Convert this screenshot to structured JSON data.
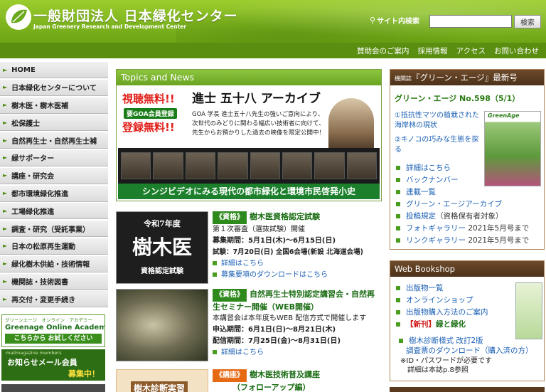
{
  "header": {
    "title": "一般財団法人 日本緑化センター",
    "subtitle": "Japan Greenery Research and Development Center",
    "search_label": "サイト内検索",
    "search_placeholder": "",
    "search_button": "検索"
  },
  "topnav": [
    "賛助会のご案内",
    "採用情報",
    "アクセス",
    "お問い合わせ"
  ],
  "sidebar": {
    "items": [
      "HOME",
      "日本緑化センターについて",
      "樹木医・樹木医補",
      "松保護士",
      "自然再生士・自然再生士補",
      "緑サポーター",
      "講座・研究会",
      "都市環境緑化推進",
      "工場緑化推進",
      "調査・研究（受託事業）",
      "日本の松原再生運動",
      "緑化樹木供給・技術情報",
      "機関誌・技術図書",
      "再交付・変更手続き"
    ],
    "banner1": {
      "top": "グリーンエージ　オンライン　アカデミー",
      "title": "Greenage Online Academy",
      "button": "こちらから お試しください"
    },
    "banner2": {
      "top": "mailmagazine members",
      "line1": "お知らせメール会員",
      "line2": "募集中！"
    }
  },
  "topics": {
    "heading": "Topics and News",
    "feature": {
      "badge1": "視聴無料!!",
      "badge2": "要GOA会員登録",
      "badge3": "登録無料!!",
      "title": "進士 五十八 アーカイブ",
      "lines": [
        "GOA 学長 進士五十八先生の強いご意向により、",
        "次世代のみどりに関わる幅広い技術者に向けて、",
        "先生からお預かりした過去の映像を限定公開中！"
      ],
      "caption": "シンジビデオにみる現代の都市緑化と環境市民啓発小史"
    }
  },
  "news": [
    {
      "tag": "《資格》",
      "title": "樹木医資格認定試験",
      "thumb": {
        "a": "令和7年度",
        "b": "樹木医",
        "c": "資格認定試験"
      },
      "lines": [
        {
          "text": "第１次審査（選抜試験）開催",
          "bold": false
        },
        {
          "text": "募集期間：5月1日(木)～6月15日(日)",
          "bold": true
        },
        {
          "text": "試験：7月20日(日) 全国6会場(新設 北海道会場)",
          "bold": true
        }
      ],
      "links": [
        "詳細はこちら",
        "募集要項のダウンロードはこちら"
      ]
    },
    {
      "tag": "《資格》",
      "title": "自然再生士特別認定講習会・自然再生セミナー開催（WEB開催）",
      "lines": [
        {
          "text": "本講習会は本年度もWEB 配信方式で開催します",
          "bold": false
        },
        {
          "text": "申込期間：6月1日(日)～8月21日(木)",
          "bold": true
        },
        {
          "text": "配信期間：7月25日(金)～8月31日(日)",
          "bold": true
        }
      ],
      "links": [
        "詳細はこちら"
      ]
    },
    {
      "tag": "《講座》",
      "title": "樹木医技術普及講座",
      "subtitle": "（フォローアップ編）",
      "thumb": {
        "a": "樹木診断実習"
      }
    }
  ],
  "greenage": {
    "heading_small": "機関誌",
    "heading": "『グリーン・エージ』最新号",
    "issue": "グリーン・エージ No.598（5/1）",
    "cover_title": "GreenAge",
    "articles": [
      "①抵抗性マツの植栽された海岸林の現状",
      "②キノコの巧みな生態を探る"
    ],
    "links": [
      {
        "text": "詳細はこちら",
        "note": ""
      },
      {
        "text": "バックナンバー",
        "note": ""
      },
      {
        "text": "連載一覧",
        "note": ""
      },
      {
        "text": "グリーン・エージアーカイブ",
        "note": ""
      },
      {
        "text": "投稿規定",
        "note": "（資格保有者対象）"
      },
      {
        "text": "フォトギャラリー",
        "note": " 2021年5月号まで"
      },
      {
        "text": "リンクギャラリー",
        "note": " 2021年5月号まで"
      }
    ]
  },
  "bookshop": {
    "heading": "Web Bookshop",
    "links": [
      "出版物一覧",
      "オンラインショップ",
      "出版物購入方法のご案内"
    ],
    "new_tag": "【新刊】",
    "new_title": "緑と緑化",
    "form_link_line1": "樹木診断様式 改訂2版",
    "form_link_line2": "調査票のダウンロード（購入済の方）",
    "note1": "※ID・パスワードが必要です",
    "note2": "詳細は本誌p.8参照"
  },
  "colors": {
    "brand_green": "#7fb51f",
    "nav_green": "#5a8e10",
    "box_brown": "#5a3a1f",
    "link_blue": "#1a5fb4"
  }
}
